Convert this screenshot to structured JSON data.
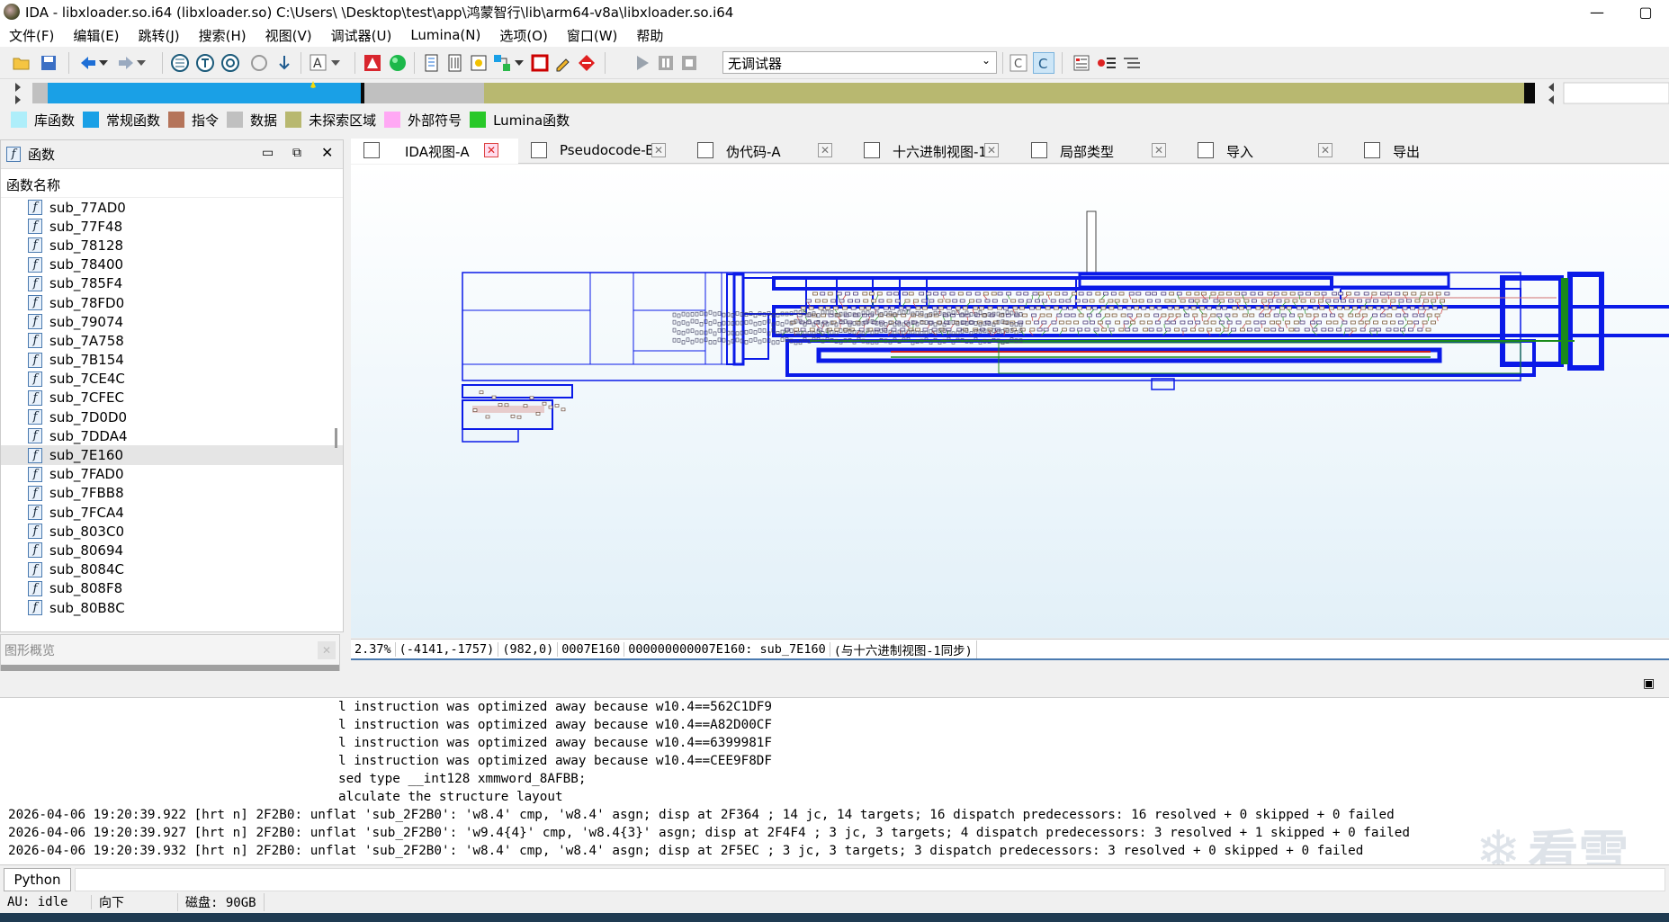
{
  "window": {
    "title": "IDA - libxloader.so.i64 (libxloader.so) C:\\Users\\    \\Desktop\\test\\app\\鸿蒙智行\\lib\\arm64-v8a\\libxloader.so.i64",
    "minimize": "—",
    "maximize": "▢"
  },
  "menu": [
    "文件(F)",
    "编辑(E)",
    "跳转(J)",
    "搜索(H)",
    "视图(V)",
    "调试器(U)",
    "Lumina(N)",
    "选项(O)",
    "窗口(W)",
    "帮助"
  ],
  "toolbar": {
    "debugger_value": "无调试器"
  },
  "legend": [
    {
      "label": "库函数",
      "color": "#aeeefa"
    },
    {
      "label": "常规函数",
      "color": "#1aa0e6"
    },
    {
      "label": "指令",
      "color": "#b5745a"
    },
    {
      "label": "数据",
      "color": "#c0c0c0"
    },
    {
      "label": "未探索区域",
      "color": "#b8b870"
    },
    {
      "label": "外部符号",
      "color": "#ffa8f4"
    },
    {
      "label": "Lumina函数",
      "color": "#28c828"
    }
  ],
  "functions_panel": {
    "title": "函数",
    "column": "函数名称",
    "items": [
      "sub_77AD0",
      "sub_77F48",
      "sub_78128",
      "sub_78400",
      "sub_785F4",
      "sub_78FD0",
      "sub_79074",
      "sub_7A758",
      "sub_7B154",
      "sub_7CE4C",
      "sub_7CFEC",
      "sub_7D0D0",
      "sub_7DDA4",
      "sub_7E160",
      "sub_7FAD0",
      "sub_7FBB8",
      "sub_7FCA4",
      "sub_803C0",
      "sub_80694",
      "sub_8084C",
      "sub_808F8",
      "sub_80B8C"
    ],
    "selected": "sub_7E160"
  },
  "overview_panel": {
    "title": "图形概览"
  },
  "tabs": [
    {
      "label": "IDA视图-A",
      "active": true
    },
    {
      "label": "Pseudocode-B",
      "active": false
    },
    {
      "label": "伪代码-A",
      "active": false
    },
    {
      "label": "十六进制视图-1",
      "active": false
    },
    {
      "label": "局部类型",
      "active": false
    },
    {
      "label": "导入",
      "active": false
    },
    {
      "label": "导出",
      "active": false
    }
  ],
  "status": {
    "zoom": "2.37%",
    "cursor": "(-4141,-1757)",
    "pos": "(982,0)",
    "offset": "0007E160",
    "address": "000000000007E160: sub_7E160",
    "sync": "(与十六进制视图-1同步)"
  },
  "output_lines": [
    "l instruction was optimized away because w10.4==562C1DF9",
    "l instruction was optimized away because w10.4==A82D00CF",
    "l instruction was optimized away because w10.4==6399981F",
    "l instruction was optimized away because w10.4==CEE9F8DF",
    "sed type __int128 xmmword_8AFBB;",
    "alculate the structure layout",
    "2026-04-06 19:20:39.922 [hrt n] 2F2B0: unflat 'sub_2F2B0': 'w8.4' cmp, 'w8.4' asgn; disp at 2F364 ; 14 jc, 14 targets; 16 dispatch predecessors: 16 resolved + 0 skipped + 0 failed",
    "2026-04-06 19:20:39.927 [hrt n] 2F2B0: unflat 'sub_2F2B0': 'w9.4{4}' cmp, 'w8.4{3}' asgn; disp at 2F4F4 ; 3 jc, 3 targets; 4 dispatch predecessors: 3 resolved + 1 skipped + 0 failed",
    "2026-04-06 19:20:39.932 [hrt n] 2F2B0: unflat 'sub_2F2B0': 'w8.4' cmp, 'w8.4' asgn; disp at 2F5EC ; 3 jc, 3 targets; 3 dispatch predecessors: 3 resolved + 0 skipped + 0 failed"
  ],
  "python_button": "Python",
  "footer": {
    "au": "AU:  idle",
    "direction": "向下",
    "disk": "磁盘: 90GB"
  },
  "watermark": "看雪"
}
